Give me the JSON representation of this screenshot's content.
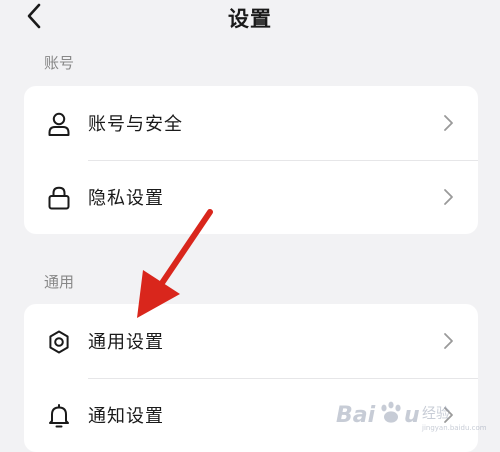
{
  "header": {
    "title": "设置",
    "back_icon": "chevron-left-icon"
  },
  "sections": [
    {
      "title": "账号",
      "items": [
        {
          "label": "账号与安全",
          "icon": "user-icon"
        },
        {
          "label": "隐私设置",
          "icon": "lock-icon"
        }
      ]
    },
    {
      "title": "通用",
      "items": [
        {
          "label": "通用设置",
          "icon": "gear-icon"
        },
        {
          "label": "通知设置",
          "icon": "bell-icon"
        }
      ]
    }
  ],
  "annotation": {
    "arrow_color": "#d9261c"
  },
  "watermark": {
    "text": "Baidu经验"
  }
}
